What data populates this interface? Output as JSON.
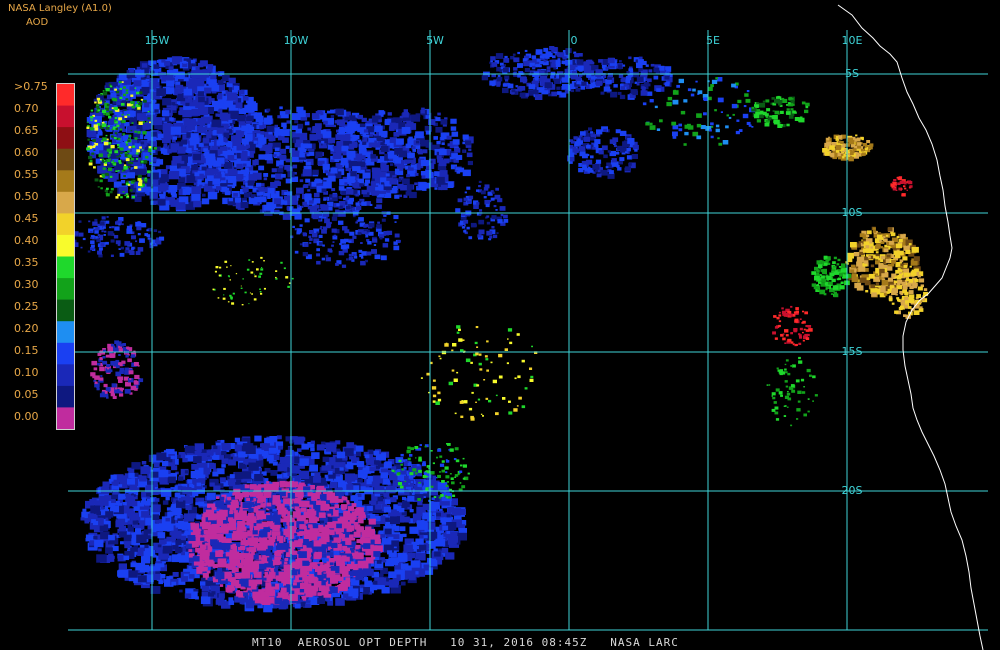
{
  "header": {
    "provider": "NASA Langley (A1.0)",
    "units": "AOD"
  },
  "legend": {
    "labels": [
      ">0.75",
      "0.70",
      "0.65",
      "0.60",
      "0.55",
      "0.50",
      "0.45",
      "0.40",
      "0.35",
      "0.30",
      "0.25",
      "0.20",
      "0.15",
      "0.10",
      "0.05",
      "0.00"
    ],
    "colors": [
      "#ff2a2a",
      "#c8102e",
      "#8e0f14",
      "#6e4a14",
      "#a57a1a",
      "#d8a84a",
      "#f2d22a",
      "#f8fb2c",
      "#1fd82c",
      "#12a21a",
      "#0a5c14",
      "#1e8ef2",
      "#1a40f2",
      "#1a28b8",
      "#0e1880",
      "#c02c9e"
    ]
  },
  "grid": {
    "lon_labels": [
      "15W",
      "10W",
      "5W",
      "0",
      "5E",
      "10E"
    ],
    "lat_labels": [
      "5S",
      "10S",
      "15S",
      "20S"
    ],
    "color": "#3fd4d8"
  },
  "footer": {
    "caption": "MT10  AEROSOL OPT DEPTH   10 31, 2016 08:45Z   NASA LARC"
  }
}
